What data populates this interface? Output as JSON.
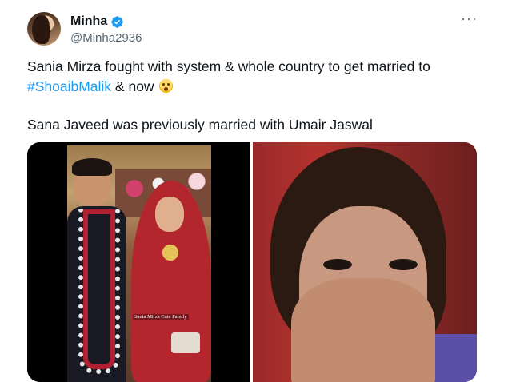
{
  "author": {
    "display_name": "Minha",
    "handle": "@Minha2936",
    "verified": true
  },
  "more_menu": "···",
  "tweet": {
    "line1": "Sania Mirza fought with system & whole country to get married to",
    "line2_hashtag": "#ShoaibMalik",
    "line2_rest": " & now",
    "line3": "Sana Javeed was previously married with Umair Jaswal"
  },
  "media": {
    "left_caption": "Sania Mirza Cute Family"
  },
  "colors": {
    "link": "#1d9bf0",
    "verified": "#1d9bf0",
    "text": "#0f1419",
    "secondary": "#536471"
  }
}
